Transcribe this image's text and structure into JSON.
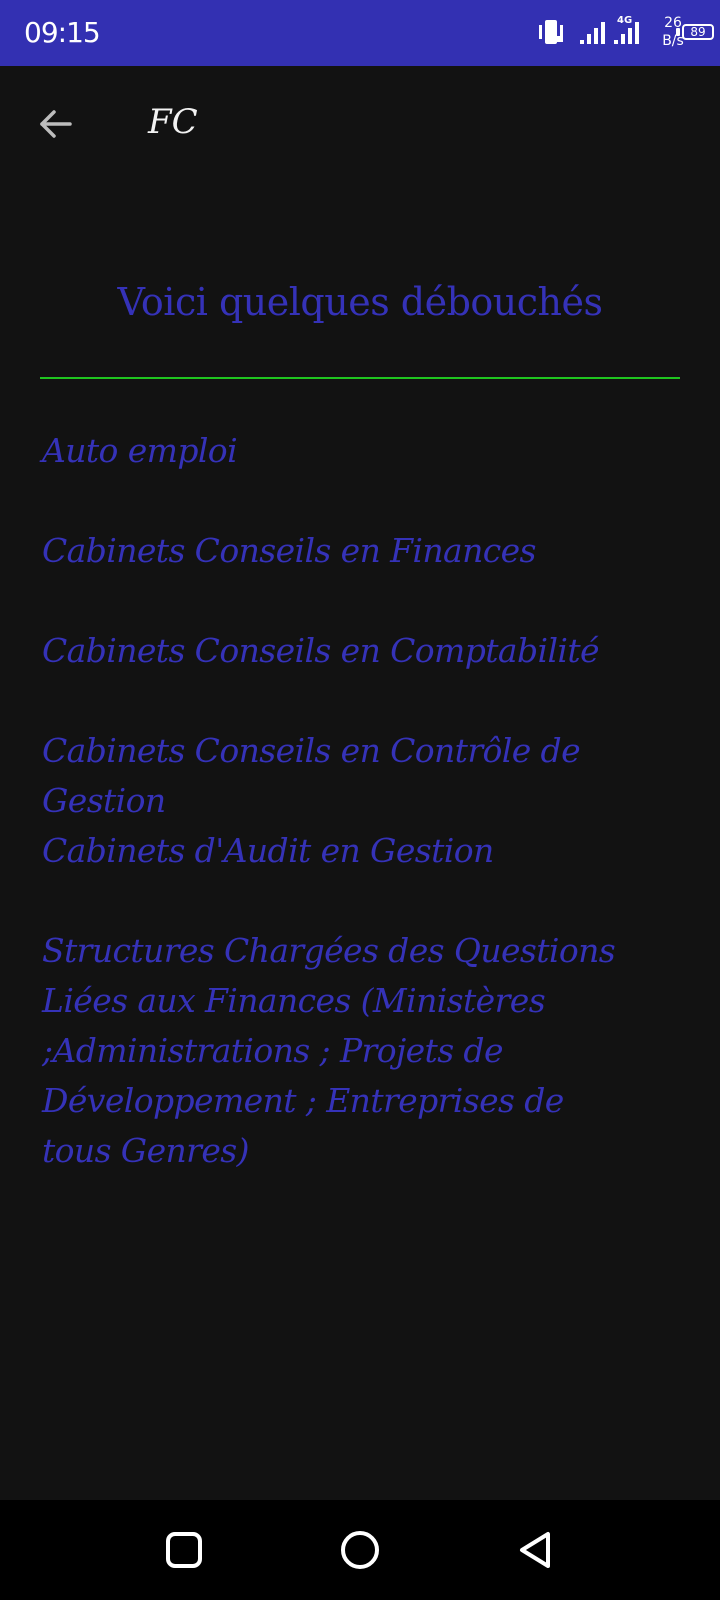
{
  "status_bar": {
    "time": "09:15",
    "network_type": "4G",
    "net_speed_value": "26",
    "net_speed_unit": "B/s",
    "battery_level": "89",
    "background_color": "#3330b2"
  },
  "app_bar": {
    "title": "FC",
    "back_icon": "arrow-left-icon"
  },
  "content": {
    "heading": "Voici quelques débouchés",
    "divider_color": "#1fc51f",
    "text_color": "#3532b8",
    "outlets": [
      "Auto emploi",
      "Cabinets Conseils en Finances",
      "Cabinets Conseils en Comptabilité",
      "Cabinets Conseils en Contrôle de Gestion",
      "Cabinets d'Audit en Gestion",
      "Structures Chargées des Questions Liées aux Finances (Ministères ;Administrations ; Projets de Développement ; Entreprises de tous Genres)"
    ]
  },
  "nav_bar": {
    "recent_icon": "square-icon",
    "home_icon": "circle-icon",
    "back_icon": "triangle-back-icon"
  }
}
